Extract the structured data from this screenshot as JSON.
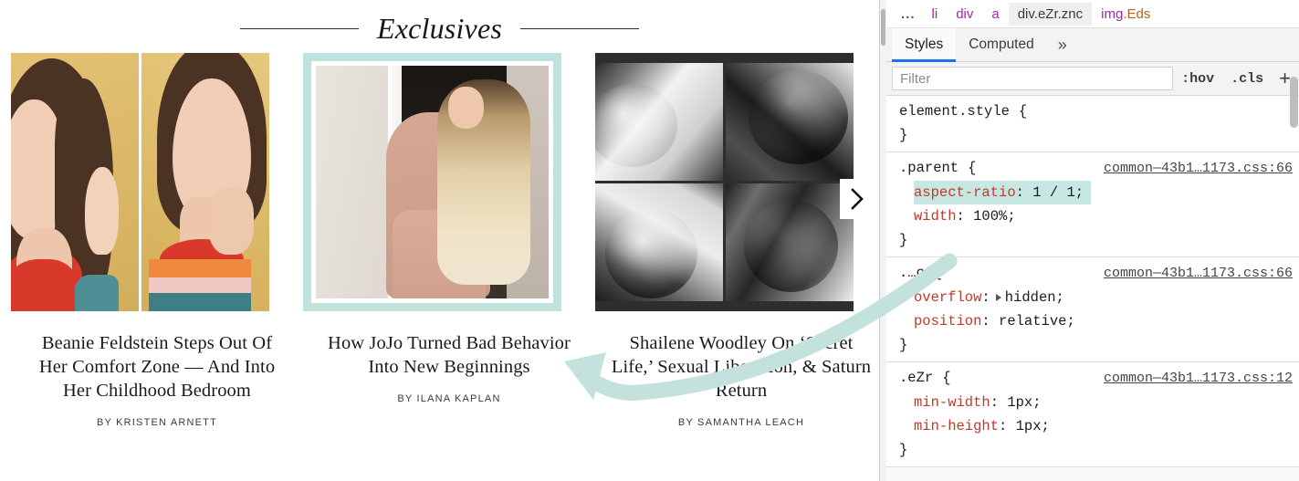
{
  "page": {
    "section_title": "Exclusives",
    "next_button_icon": "chevron-right-icon",
    "cards": [
      {
        "headline": "Beanie Feldstein Steps Out Of Her Comfort Zone — And Into Her Childhood Bedroom",
        "byline": "BY KRISTEN ARNETT",
        "image_alt": "two-panel-color-portrait"
      },
      {
        "headline": "How JoJo Turned Bad Behavior Into New Beginnings",
        "byline": "BY ILANA KAPLAN",
        "image_alt": "pink-outfit-doorway-portrait",
        "selected": true,
        "highlight_color": "#bfe2dd"
      },
      {
        "headline": "Shailene Woodley On ‘Secret Life,’ Sexual Liberation, & Saturn Return",
        "byline": "BY SAMANTHA LEACH",
        "image_alt": "black-and-white-four-panel-grid"
      }
    ]
  },
  "devtools": {
    "breadcrumb": [
      {
        "text": "...",
        "kind": "dots"
      },
      {
        "text": "li",
        "kind": "tag"
      },
      {
        "text": "div",
        "kind": "tag"
      },
      {
        "text": "a",
        "kind": "tag"
      },
      {
        "text": "div.eZr.znc",
        "kind": "selected"
      },
      {
        "tag": "img",
        "cls": ".Eds",
        "kind": "tagclass"
      }
    ],
    "tabs": [
      {
        "label": "Styles",
        "active": true
      },
      {
        "label": "Computed",
        "active": false
      },
      {
        "label": "»",
        "active": false,
        "icon": "more-tabs-icon"
      }
    ],
    "filter": {
      "placeholder": "Filter",
      "value": ""
    },
    "toolbar": {
      "hov": ":hov",
      "cls": ".cls",
      "add_rule": "+"
    },
    "rules": [
      {
        "selector": "element.style",
        "origin": "",
        "declarations": []
      },
      {
        "selector": ".parent",
        "origin": "common—43b1…1173.css:66",
        "declarations": [
          {
            "prop": "aspect-ratio",
            "value": "1 / 1;",
            "highlighted": true
          },
          {
            "prop": "width",
            "value": "100%;",
            "highlighted": false
          }
        ]
      },
      {
        "selector": ".…c",
        "origin": "common—43b1…1173.css:66",
        "declarations": [
          {
            "prop": "overflow",
            "value": "hidden;",
            "highlighted": false,
            "expandable": true
          },
          {
            "prop": "position",
            "value": "relative;",
            "highlighted": false
          }
        ]
      },
      {
        "selector": ".eZr",
        "origin": "common—43b1…1173.css:12",
        "declarations": [
          {
            "prop": "min-width",
            "value": "1px;",
            "highlighted": false
          },
          {
            "prop": "min-height",
            "value": "1px;",
            "highlighted": false
          }
        ]
      }
    ]
  },
  "annotation": {
    "arrow_color": "#c3e2dd",
    "arrow_name": "curved-left-pointing-arrow"
  }
}
